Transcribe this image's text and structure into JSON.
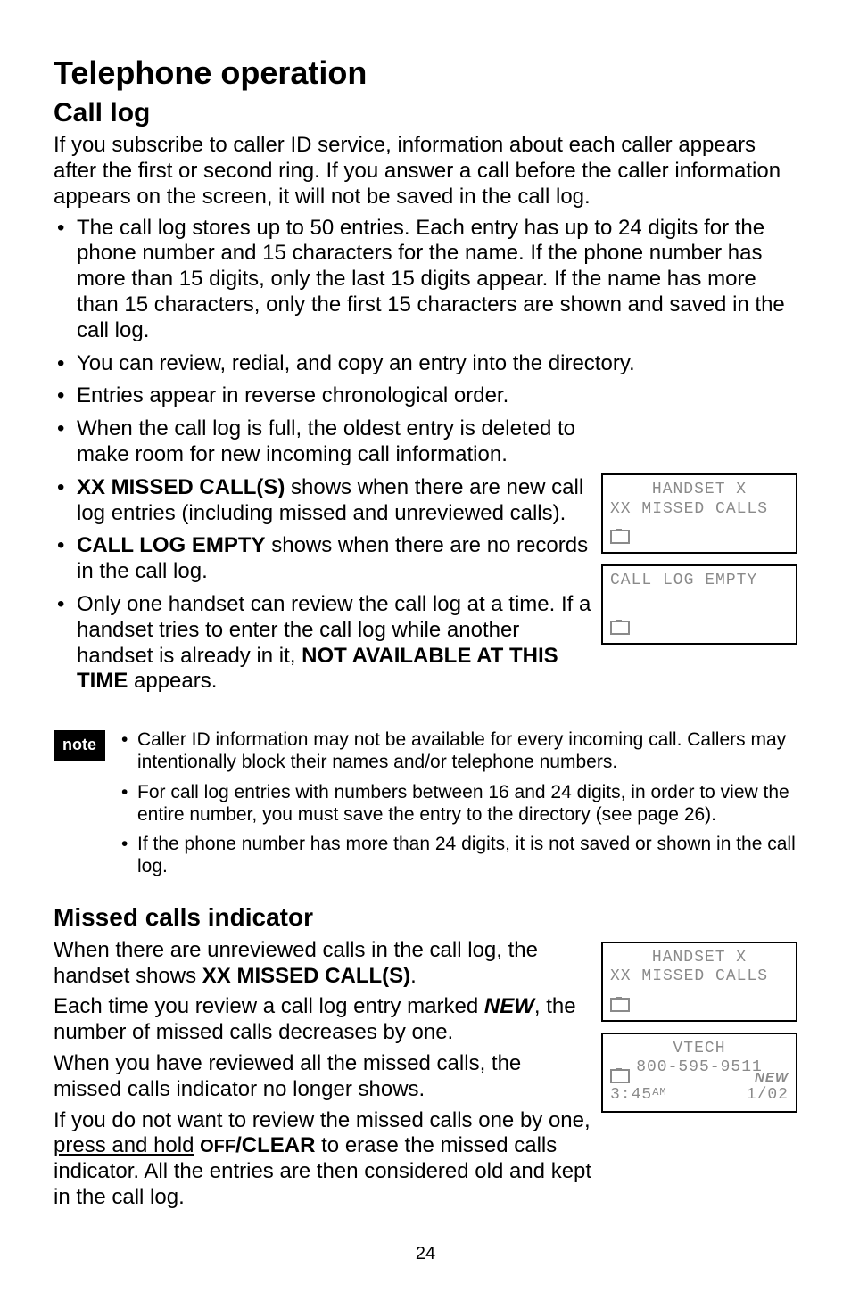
{
  "title": "Telephone operation",
  "section1_heading": "Call log",
  "section1_para1": "If you subscribe to caller ID service, information about each caller appears after the first or second ring. If you answer a call before the caller information appears on the screen, it will not be saved in the call log.",
  "section1_bullets": {
    "b1": "The call log stores up to 50 entries. Each entry has up to 24 digits for the phone number and 15 characters for the name. If the phone number has more than 15 digits, only the last 15 digits appear. If the name has more than 15 characters, only the first 15 characters are shown and saved in the call log.",
    "b2": "You can review, redial, and copy an entry into the directory.",
    "b3": "Entries appear in reverse chronological order.",
    "b4": "When the call log is full, the oldest entry is deleted to make room for new incoming call information.",
    "b5_strong": "XX MISSED CALL(S)",
    "b5_rest": " shows when there are new call log entries (including missed and unreviewed calls).",
    "b6_strong": "CALL LOG EMPTY",
    "b6_rest": " shows when there are no records in the call log.",
    "b7_a": "Only one handset can review the call log at a time. If a handset tries to enter the call log while another handset is already in it, ",
    "b7_strong": "NOT AVAILABLE AT THIS TIME",
    "b7_b": " appears."
  },
  "note_label": "note",
  "note_bullets": {
    "n1": "Caller ID information may not be available for every incoming call. Callers may intentionally block their names and/or telephone numbers.",
    "n2": "For call log entries with numbers between 16 and 24 digits, in order to view the entire number, you must save the entry to the directory (see page 26).",
    "n3": "If the phone number has more than 24 digits, it is not saved or shown in the call log."
  },
  "section2_heading": "Missed calls indicator",
  "section2_para1_a": "When there are unreviewed calls in the call log, the handset shows ",
  "section2_para1_strong": "XX MISSED CALL(S)",
  "section2_para1_b": ".",
  "section2_para2_a": "Each time you review a call log entry marked ",
  "section2_para2_em": "NEW",
  "section2_para2_b": ", the number of missed calls decreases by one.",
  "section2_para3": "When you have reviewed all the missed calls, the missed calls indicator no longer shows.",
  "section2_para4_a": "If you do not want to review the missed calls one by one, ",
  "section2_para4_u": "press and hold",
  "section2_para4_b": " ",
  "section2_para4_sc": "OFF",
  "section2_para4_strong": "/CLEAR",
  "section2_para4_c": " to erase the missed calls indicator. All the entries are then considered old and kept in the call log.",
  "lcd1": {
    "line1": "HANDSET X",
    "line2": "XX MISSED CALLS"
  },
  "lcd2": {
    "line1": "CALL LOG EMPTY"
  },
  "lcd3": {
    "line1": "HANDSET X",
    "line2": "XX MISSED CALLS"
  },
  "lcd4": {
    "line1": "VTECH",
    "line2": "800-595-9511",
    "time": "3:45",
    "ampm": "AM",
    "new": "NEW",
    "date": "1/02"
  },
  "page_num": "24"
}
